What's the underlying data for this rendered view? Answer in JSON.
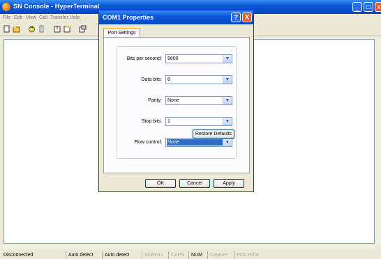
{
  "main": {
    "title": "SN Console - HyperTerminal",
    "menu": [
      "File",
      "Edit",
      "View",
      "Call",
      "Transfer",
      "Help"
    ],
    "window_controls": {
      "minimize": "_",
      "maximize": "□",
      "close": "x"
    }
  },
  "toolbar": {
    "icons": [
      "new-icon",
      "open-icon",
      "connect-icon",
      "disconnect-icon",
      "send-icon",
      "receive-icon",
      "properties-icon"
    ]
  },
  "status": {
    "items": [
      "Disconnected",
      "Auto detect",
      "Auto detect",
      "SCROLL",
      "CAPS",
      "NUM",
      "Capture",
      "Print echo"
    ],
    "active": [
      "Disconnected",
      "Auto detect",
      "Auto detect",
      "NUM"
    ]
  },
  "dialog": {
    "title": "COM1 Properties",
    "help": "?",
    "close": "X",
    "tab": "Port Settings",
    "fields": [
      {
        "label": "Bits per second:",
        "value": "9600"
      },
      {
        "label": "Data bits:",
        "value": "8"
      },
      {
        "label": "Parity:",
        "value": "None"
      },
      {
        "label": "Stop bits:",
        "value": "1"
      },
      {
        "label": "Flow control:",
        "value": "None"
      }
    ],
    "restore_label": "Restore Defaults",
    "ok_label": "OK",
    "cancel_label": "Cancel",
    "apply_label": "Apply"
  },
  "colors": {
    "title_blue": "#0a57d6",
    "selection": "#316ac5",
    "window_bg": "#ece9d8"
  }
}
